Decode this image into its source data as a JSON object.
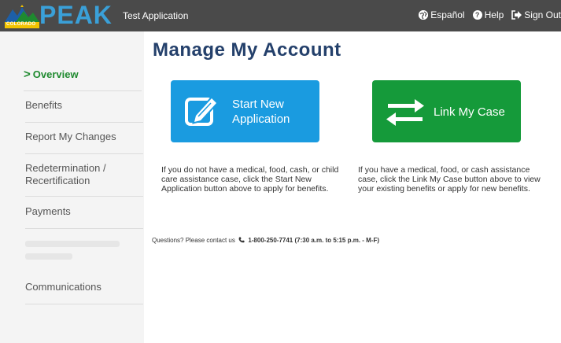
{
  "header": {
    "logo_text": "PEAK",
    "logo_state": "COLORADO",
    "app_title": "Test Application",
    "language_link": "Español",
    "help_link": "Help",
    "signout_link": "Sign Out"
  },
  "sidebar": {
    "items": [
      {
        "label": "Overview",
        "active": true
      },
      {
        "label": "Benefits"
      },
      {
        "label": "Report My Changes"
      },
      {
        "label": "Redetermination / Recertification"
      },
      {
        "label": "Payments"
      },
      {
        "label": "Communications"
      }
    ]
  },
  "main": {
    "title": "Manage My Account",
    "tiles": [
      {
        "label": "Start New Application",
        "description": "If you do not have a medical, food, cash, or child care assistance case, click the Start New Application button above to apply for benefits."
      },
      {
        "label": "Link My Case",
        "description": "If you have a medical, food, or cash assistance case, click the Link My Case button above to view your existing benefits or apply for new benefits."
      }
    ],
    "contact_prefix": "Questions? Please contact us",
    "contact_phone": "1-800-250-7741 (7:30 a.m. to 5:15 p.m. - M-F)"
  },
  "colors": {
    "topbar": "#4a4a4a",
    "blue_tile": "#1a9be0",
    "green_tile": "#159a3a",
    "title": "#24406b",
    "active_nav": "#1f8a2f"
  },
  "icons": [
    "peak-logo-mark",
    "globe-icon",
    "help-icon",
    "sign-out-icon",
    "edit-icon",
    "swap-arrows-icon",
    "phone-icon",
    "chevron-right-icon"
  ]
}
